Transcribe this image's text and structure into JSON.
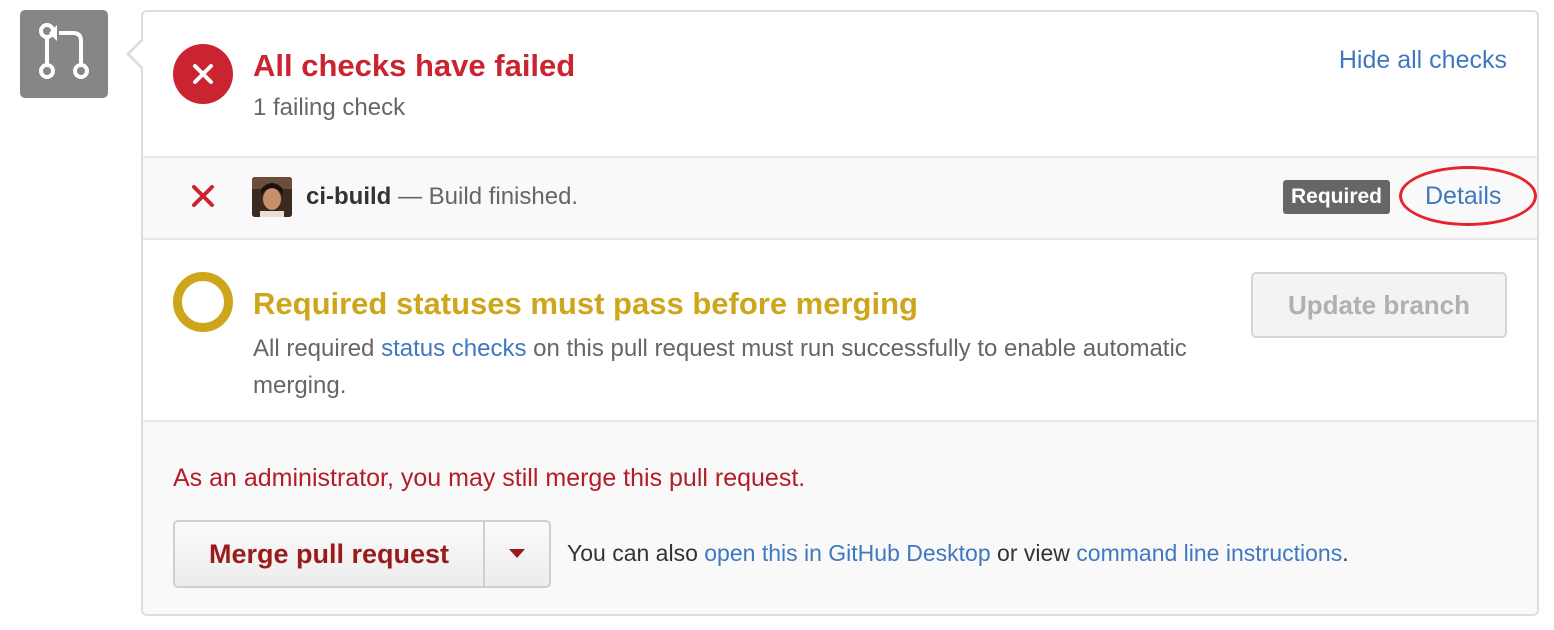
{
  "pr_icon": {
    "name": "git-pull-request-icon"
  },
  "status": {
    "title": "All checks have failed",
    "subtitle": "1 failing check",
    "hide_link": "Hide all checks",
    "color": "#cb2431"
  },
  "check": {
    "name": "ci-build",
    "separator": " — ",
    "description": "Build finished.",
    "badge": "Required",
    "details_link": "Details"
  },
  "required": {
    "title": "Required statuses must pass before merging",
    "desc_before": "All required ",
    "desc_link": "status checks",
    "desc_after": " on this pull request must run successfully to enable automatic merging.",
    "update_button": "Update branch",
    "color": "#cea61b"
  },
  "merge": {
    "admin_note": "As an administrator, you may still merge this pull request.",
    "button": "Merge pull request",
    "help_before": "You can also ",
    "help_link1": "open this in GitHub Desktop",
    "help_mid": " or view ",
    "help_link2": "command line instructions",
    "help_after": "."
  },
  "colors": {
    "link": "#4078c0",
    "annotation": "#e3242b"
  }
}
